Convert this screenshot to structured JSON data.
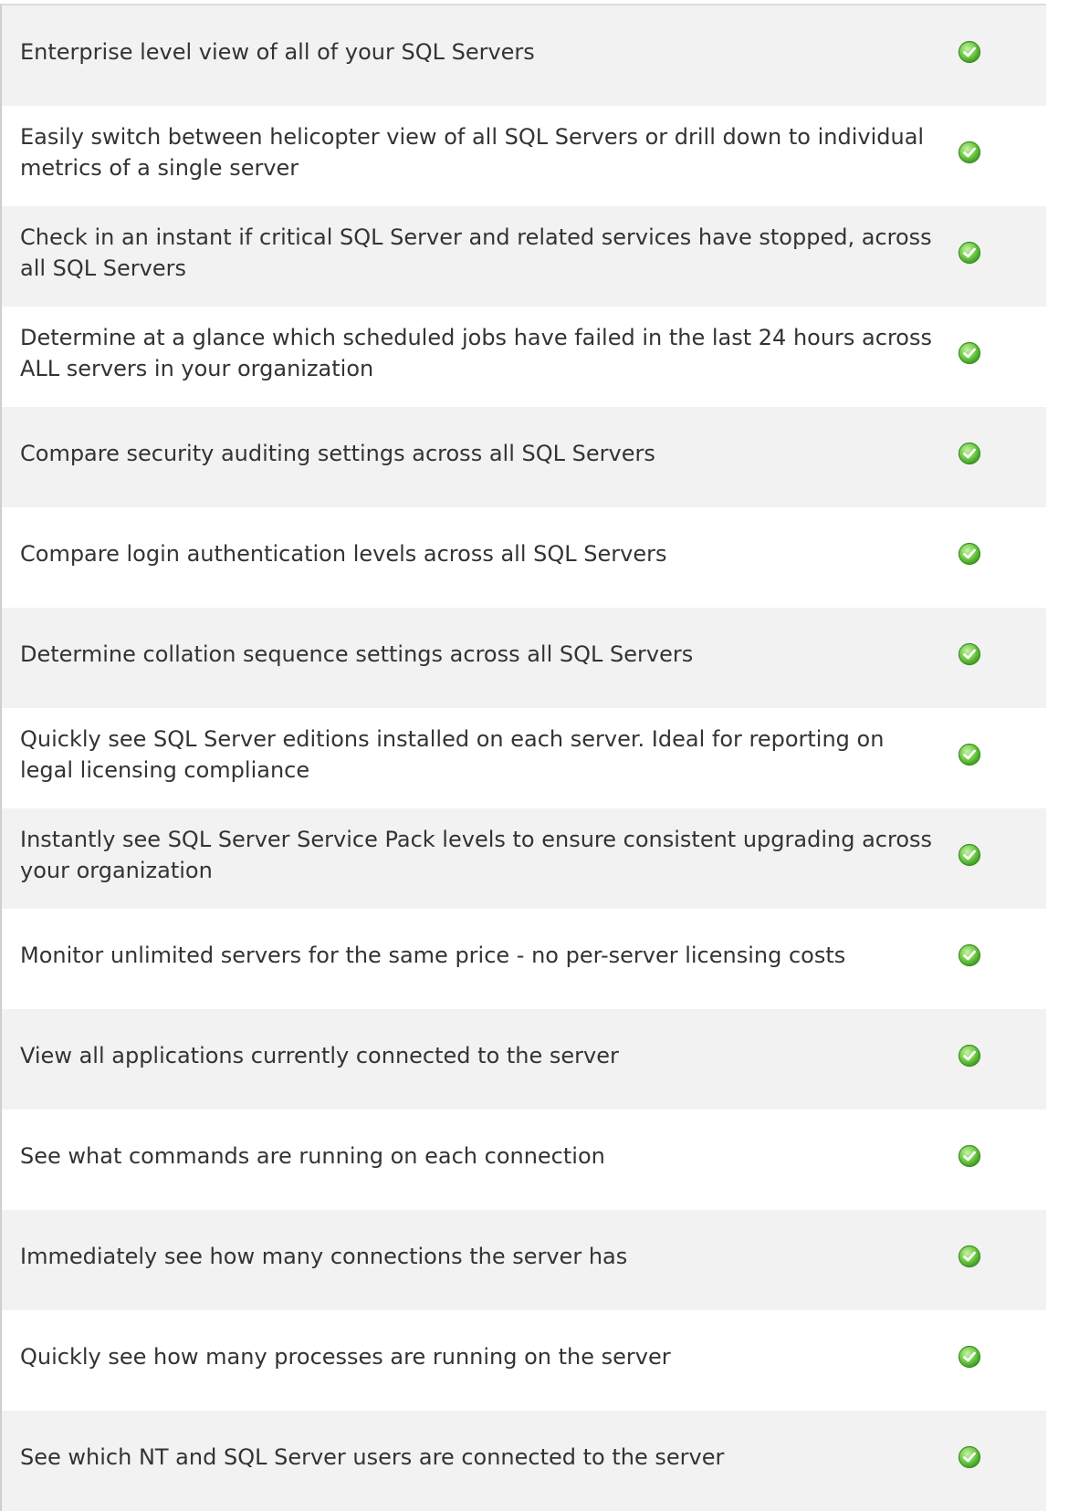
{
  "features": [
    {
      "text": "Enterprise level view of all of your SQL Servers",
      "status_icon": "green-check-icon"
    },
    {
      "text": "Easily switch between helicopter view of all SQL Servers or drill down to individual metrics of a single server",
      "status_icon": "green-check-icon"
    },
    {
      "text": "Check in an instant if critical SQL Server and related services have stopped, across all SQL Servers",
      "status_icon": "green-check-icon"
    },
    {
      "text": "Determine at a glance which scheduled jobs have failed in the last 24 hours across ALL servers in your organization",
      "status_icon": "green-check-icon"
    },
    {
      "text": "Compare security auditing settings across all SQL Servers",
      "status_icon": "green-check-icon"
    },
    {
      "text": "Compare login authentication levels across all SQL Servers",
      "status_icon": "green-check-icon"
    },
    {
      "text": "Determine collation sequence settings across all SQL Servers",
      "status_icon": "green-check-icon"
    },
    {
      "text": "Quickly see SQL Server editions installed on each server. Ideal for reporting on legal licensing compliance",
      "status_icon": "green-check-icon"
    },
    {
      "text": "Instantly see SQL Server Service Pack levels to ensure consistent upgrading across your organization",
      "status_icon": "green-check-icon"
    },
    {
      "text": "Monitor unlimited servers for the same price - no per-server licensing costs",
      "status_icon": "green-check-icon"
    },
    {
      "text": "View all applications currently connected to the server",
      "status_icon": "green-check-icon"
    },
    {
      "text": "See what commands are running on each connection",
      "status_icon": "green-check-icon"
    },
    {
      "text": "Immediately see how many connections the server has",
      "status_icon": "green-check-icon"
    },
    {
      "text": "Quickly see how many processes are running on the server",
      "status_icon": "green-check-icon"
    },
    {
      "text": "See which NT and SQL Server users are connected to the server",
      "status_icon": "green-check-icon"
    }
  ],
  "colors": {
    "row_shaded": "#f2f2f2",
    "row_plain": "#ffffff",
    "text": "#333333",
    "check_green": "#5cbf3a"
  }
}
